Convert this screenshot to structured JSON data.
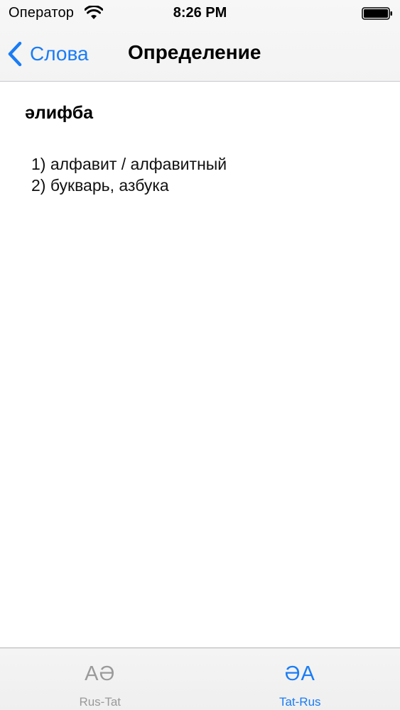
{
  "status_bar": {
    "carrier": "Оператор",
    "time": "8:26 PM",
    "wifi_icon": "wifi-icon",
    "battery_icon": "battery-icon"
  },
  "nav": {
    "back_label": "Слова",
    "back_icon": "chevron-left-icon",
    "title": "Определение",
    "accent_color": "#1a7cf5"
  },
  "entry": {
    "word": "әлифба",
    "definitions": [
      "1) алфавит / алфавитный",
      "2) букварь, азбука"
    ]
  },
  "tabs": [
    {
      "icon_text": "AƏ",
      "label": "Rus-Tat",
      "selected": false
    },
    {
      "icon_text": "ƏA",
      "label": "Tat-Rus",
      "selected": true
    }
  ],
  "colors": {
    "active_tab": "#1a7cf5",
    "inactive_tab": "#9a9a9a"
  }
}
